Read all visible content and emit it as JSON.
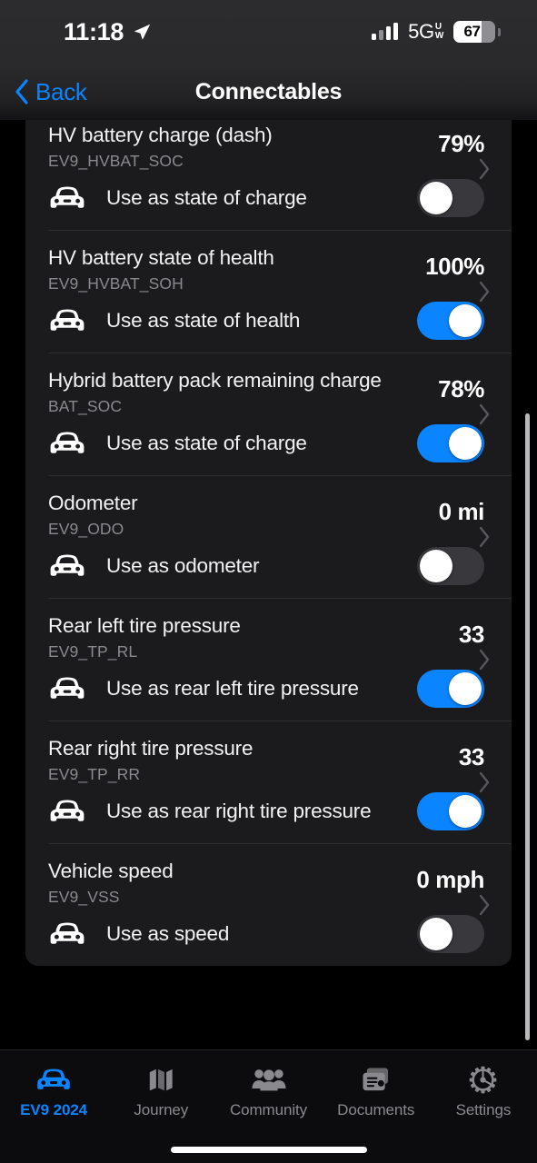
{
  "status_bar": {
    "time": "11:18",
    "location_icon": "location-arrow-icon",
    "network": "5G",
    "network_sub_top": "U",
    "network_sub_bottom": "W",
    "battery_percent": "67",
    "battery_level": 67
  },
  "nav": {
    "back_label": "Back",
    "title": "Connectables"
  },
  "rows": [
    {
      "title": "HV battery charge (dash)",
      "code": "EV9_HVBAT_SOC",
      "value": "79%",
      "toggle_label": "Use as state of charge",
      "toggle_on": false
    },
    {
      "title": "HV battery state of health",
      "code": "EV9_HVBAT_SOH",
      "value": "100%",
      "toggle_label": "Use as state of health",
      "toggle_on": true
    },
    {
      "title": "Hybrid battery pack remaining charge",
      "code": "BAT_SOC",
      "value": "78%",
      "toggle_label": "Use as state of charge",
      "toggle_on": true
    },
    {
      "title": "Odometer",
      "code": "EV9_ODO",
      "value": "0 mi",
      "toggle_label": "Use as odometer",
      "toggle_on": false
    },
    {
      "title": "Rear left tire pressure",
      "code": "EV9_TP_RL",
      "value": "33",
      "toggle_label": "Use as rear left tire pressure",
      "toggle_on": true
    },
    {
      "title": "Rear right tire pressure",
      "code": "EV9_TP_RR",
      "value": "33",
      "toggle_label": "Use as rear right tire pressure",
      "toggle_on": true
    },
    {
      "title": "Vehicle speed",
      "code": "EV9_VSS",
      "value": "0 mph",
      "toggle_label": "Use as speed",
      "toggle_on": false
    }
  ],
  "tabs": [
    {
      "label": "EV9 2024",
      "icon": "car-icon",
      "active": true
    },
    {
      "label": "Journey",
      "icon": "map-icon",
      "active": false
    },
    {
      "label": "Community",
      "icon": "people-icon",
      "active": false
    },
    {
      "label": "Documents",
      "icon": "documents-icon",
      "active": false
    },
    {
      "label": "Settings",
      "icon": "gear-icon",
      "active": false
    }
  ],
  "colors": {
    "accent": "#0a84ff",
    "background": "#000000",
    "card": "#1b1b1d",
    "toggle_off": "#39393d",
    "secondary_text": "#8a8a8e"
  }
}
